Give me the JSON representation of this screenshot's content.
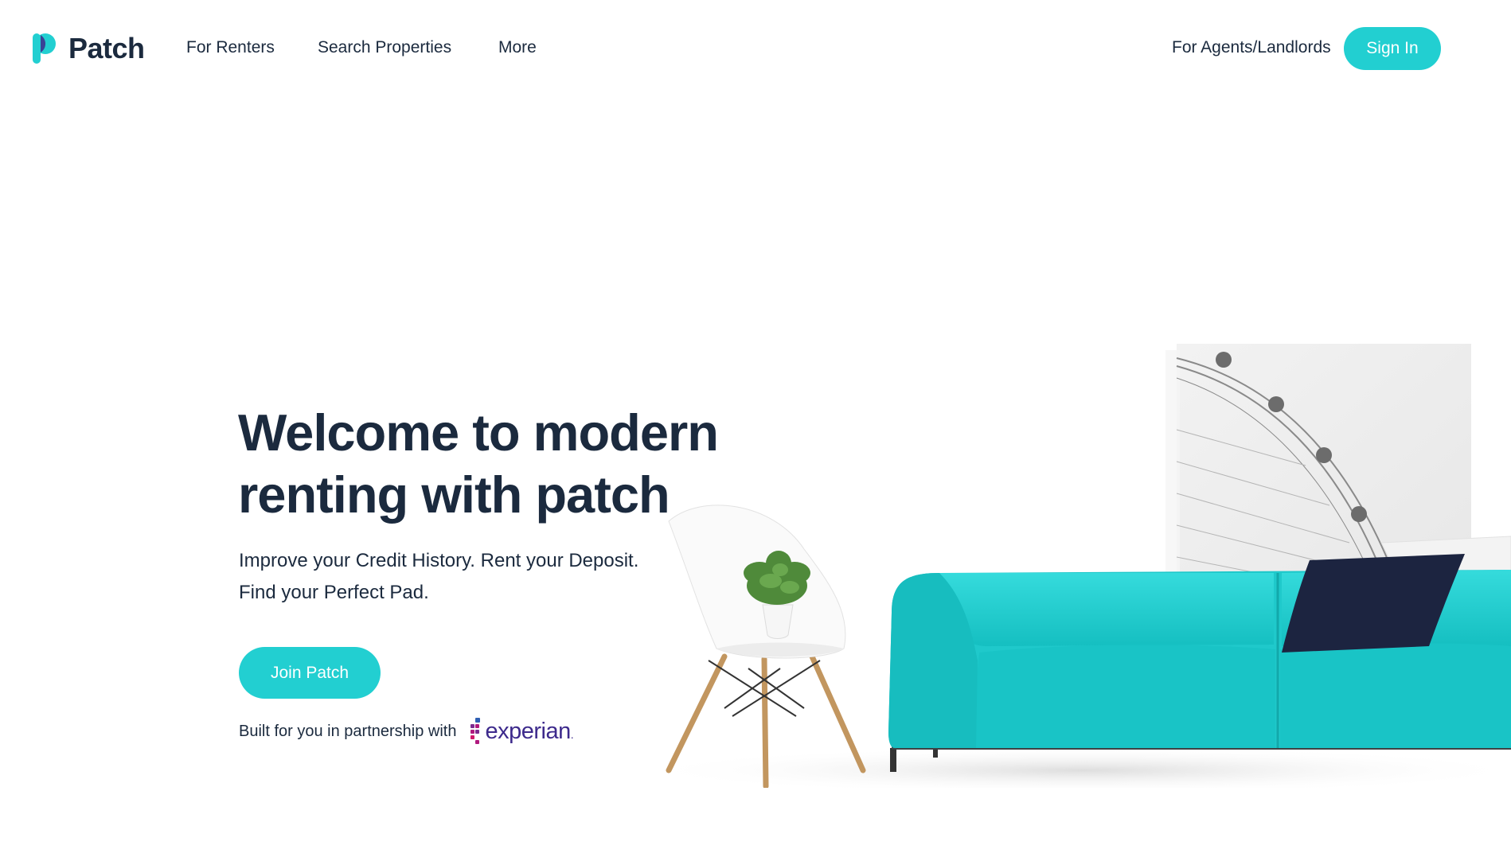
{
  "nav": {
    "brand": "Patch",
    "links": [
      "For Renters",
      "Search Properties",
      "More"
    ],
    "agents_link": "For Agents/Landlords",
    "signin_label": "Sign In"
  },
  "hero": {
    "title_line1": "Welcome to modern",
    "title_line2": "renting with patch",
    "subtitle_line1": "Improve your Credit History. Rent your Deposit.",
    "subtitle_line2": "Find your Perfect Pad.",
    "cta_label": "Join Patch",
    "partner_text": "Built for you in partnership with",
    "partner_logo": "experian",
    "partner_logo_suffix": "."
  },
  "colors": {
    "accent": "#22cfd1",
    "text": "#1b2a3e",
    "sofa": "#1fc9cb",
    "pillow": "#1c2440",
    "experian_purple": "#3d2a8c",
    "experian_magenta": "#b0197e"
  },
  "icons": {
    "logo": "patch-logo-icon",
    "partner": "experian-logo"
  },
  "illustration": {
    "objects": [
      "wall-art-ferris-wheel",
      "white-chair",
      "potted-plant",
      "turquoise-sofa",
      "navy-pillow",
      "white-pillow"
    ]
  }
}
